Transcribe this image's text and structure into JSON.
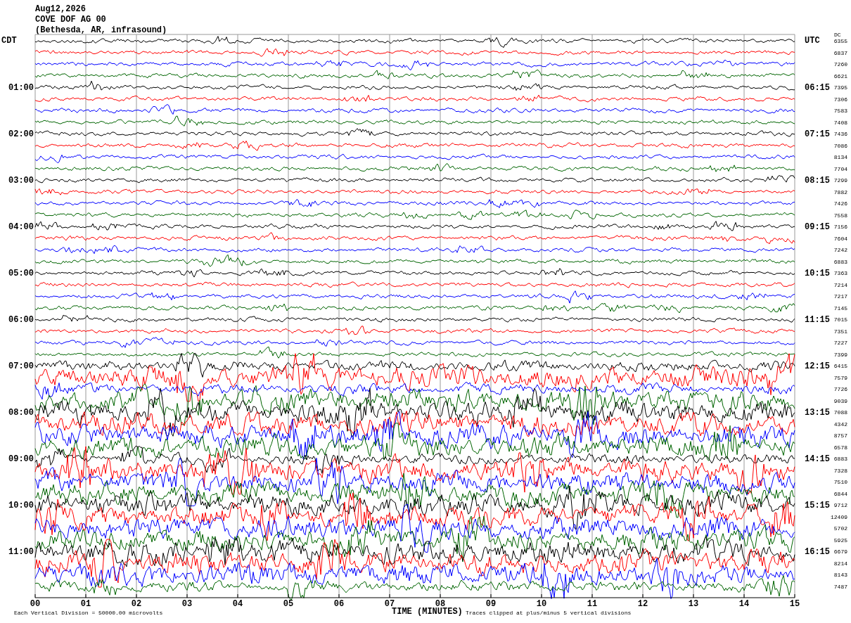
{
  "header": {
    "date": "Aug12,2026",
    "station": "COVE DOF AG 00",
    "location": "(Bethesda, AR, infrasound)"
  },
  "left_axis_title": "CDT",
  "right_axis_title": "UTC",
  "dc_title": "DC",
  "traces": [
    {
      "color": "#000000",
      "dc": "6355",
      "kind": "quiet"
    },
    {
      "color": "#ff0000",
      "dc": "6837",
      "kind": "quiet"
    },
    {
      "color": "#0000ff",
      "dc": "7260",
      "kind": "quiet"
    },
    {
      "color": "#006400",
      "dc": "6621",
      "kind": "quiet"
    },
    {
      "color": "#000000",
      "local_time": "01:00",
      "utc_time": "06:15",
      "dc": "7395",
      "kind": "quiet"
    },
    {
      "color": "#ff0000",
      "dc": "7306",
      "kind": "quiet"
    },
    {
      "color": "#0000ff",
      "dc": "7583",
      "kind": "quiet"
    },
    {
      "color": "#006400",
      "dc": "7408",
      "kind": "quiet"
    },
    {
      "color": "#000000",
      "local_time": "02:00",
      "utc_time": "07:15",
      "dc": "7436",
      "kind": "quiet"
    },
    {
      "color": "#ff0000",
      "dc": "7086",
      "kind": "quiet"
    },
    {
      "color": "#0000ff",
      "dc": "8134",
      "kind": "quiet"
    },
    {
      "color": "#006400",
      "dc": "7704",
      "kind": "quiet"
    },
    {
      "color": "#000000",
      "local_time": "03:00",
      "utc_time": "08:15",
      "dc": "7299",
      "kind": "quiet"
    },
    {
      "color": "#ff0000",
      "dc": "7882",
      "kind": "quiet"
    },
    {
      "color": "#0000ff",
      "dc": "7426",
      "kind": "quiet"
    },
    {
      "color": "#006400",
      "dc": "7558",
      "kind": "quiet"
    },
    {
      "color": "#000000",
      "local_time": "04:00",
      "utc_time": "09:15",
      "dc": "7156",
      "kind": "quiet"
    },
    {
      "color": "#ff0000",
      "dc": "7604",
      "kind": "quiet"
    },
    {
      "color": "#0000ff",
      "dc": "7242",
      "kind": "quiet"
    },
    {
      "color": "#006400",
      "dc": "6883",
      "kind": "quiet"
    },
    {
      "color": "#000000",
      "local_time": "05:00",
      "utc_time": "10:15",
      "dc": "7363",
      "kind": "quiet"
    },
    {
      "color": "#ff0000",
      "dc": "7214",
      "kind": "quiet"
    },
    {
      "color": "#0000ff",
      "dc": "7217",
      "kind": "quiet"
    },
    {
      "color": "#006400",
      "dc": "7145",
      "kind": "quiet"
    },
    {
      "color": "#000000",
      "local_time": "06:00",
      "utc_time": "11:15",
      "dc": "7015",
      "kind": "quiet"
    },
    {
      "color": "#ff0000",
      "dc": "7351",
      "kind": "quiet"
    },
    {
      "color": "#0000ff",
      "dc": "7227",
      "kind": "quiet"
    },
    {
      "color": "#006400",
      "dc": "7399",
      "kind": "quiet"
    },
    {
      "color": "#000000",
      "local_time": "07:00",
      "utc_time": "12:15",
      "dc": "6415",
      "kind": "busy"
    },
    {
      "color": "#ff0000",
      "dc": "7579",
      "kind": "noisy"
    },
    {
      "color": "#0000ff",
      "dc": "7726",
      "kind": "busy"
    },
    {
      "color": "#006400",
      "dc": "9039",
      "kind": "noisy"
    },
    {
      "color": "#000000",
      "local_time": "08:00",
      "utc_time": "13:15",
      "dc": "7088",
      "kind": "noisy"
    },
    {
      "color": "#ff0000",
      "dc": "4342",
      "kind": "noisy"
    },
    {
      "color": "#0000ff",
      "dc": "8757",
      "kind": "noisy"
    },
    {
      "color": "#006400",
      "dc": "6578",
      "kind": "noisy"
    },
    {
      "color": "#000000",
      "local_time": "09:00",
      "utc_time": "14:15",
      "dc": "6883",
      "kind": "busy"
    },
    {
      "color": "#ff0000",
      "dc": "7328",
      "kind": "noisy"
    },
    {
      "color": "#0000ff",
      "dc": "7510",
      "kind": "noisy"
    },
    {
      "color": "#006400",
      "dc": "6844",
      "kind": "noisy"
    },
    {
      "color": "#000000",
      "local_time": "10:00",
      "utc_time": "15:15",
      "dc": "9712",
      "kind": "noisy"
    },
    {
      "color": "#ff0000",
      "dc": "12409",
      "kind": "noisy"
    },
    {
      "color": "#0000ff",
      "dc": "5702",
      "kind": "noisy"
    },
    {
      "color": "#006400",
      "dc": "5925",
      "kind": "noisy"
    },
    {
      "color": "#000000",
      "local_time": "11:00",
      "utc_time": "16:15",
      "dc": "6679",
      "kind": "noisy"
    },
    {
      "color": "#ff0000",
      "dc": "8214",
      "kind": "noisy"
    },
    {
      "color": "#0000ff",
      "dc": "8143",
      "kind": "noisy"
    },
    {
      "color": "#006400",
      "dc": "7487",
      "kind": "busy"
    }
  ],
  "x_axis": {
    "ticks": [
      "00",
      "01",
      "02",
      "03",
      "04",
      "05",
      "06",
      "07",
      "08",
      "09",
      "10",
      "11",
      "12",
      "13",
      "14",
      "15"
    ],
    "title": "TIME (MINUTES)"
  },
  "footer": {
    "scale_note": "Each Vertical Division = 50000.00 microvolts",
    "clip_note": "Traces clipped at plus/minus 5 vertical divisions"
  }
}
